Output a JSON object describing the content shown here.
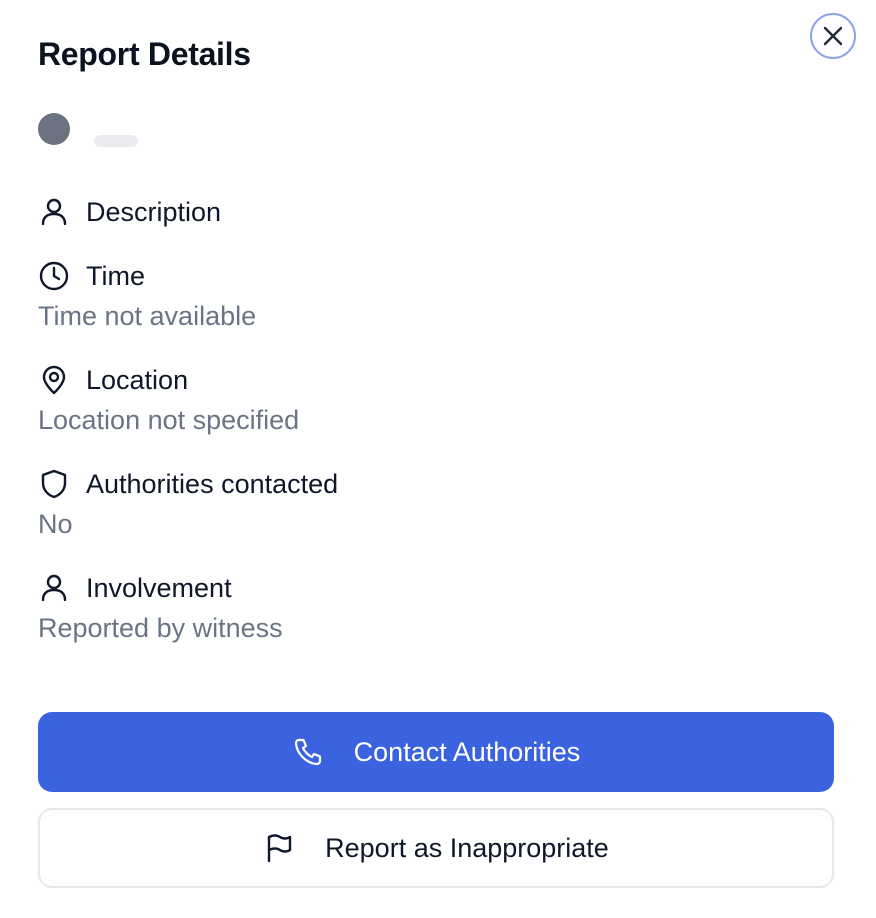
{
  "dialog": {
    "title": "Report Details",
    "close_icon": "close-icon"
  },
  "reporter": {
    "avatar_color": "#6b7280",
    "name": ""
  },
  "details": [
    {
      "icon": "user-icon",
      "label": "Description",
      "value": ""
    },
    {
      "icon": "clock-icon",
      "label": "Time",
      "value": "Time not available"
    },
    {
      "icon": "map-pin-icon",
      "label": "Location",
      "value": "Location not specified"
    },
    {
      "icon": "shield-icon",
      "label": "Authorities contacted",
      "value": "No"
    },
    {
      "icon": "user-icon",
      "label": "Involvement",
      "value": "Reported by witness"
    }
  ],
  "actions": {
    "contact": {
      "label": "Contact Authorities",
      "icon": "phone-icon",
      "color": "#3b63e0"
    },
    "report": {
      "label": "Report as Inappropriate",
      "icon": "flag-icon"
    }
  },
  "colors": {
    "accent": "#3b63e0",
    "muted_text": "#6b7487",
    "close_ring": "#8aa2e8"
  }
}
